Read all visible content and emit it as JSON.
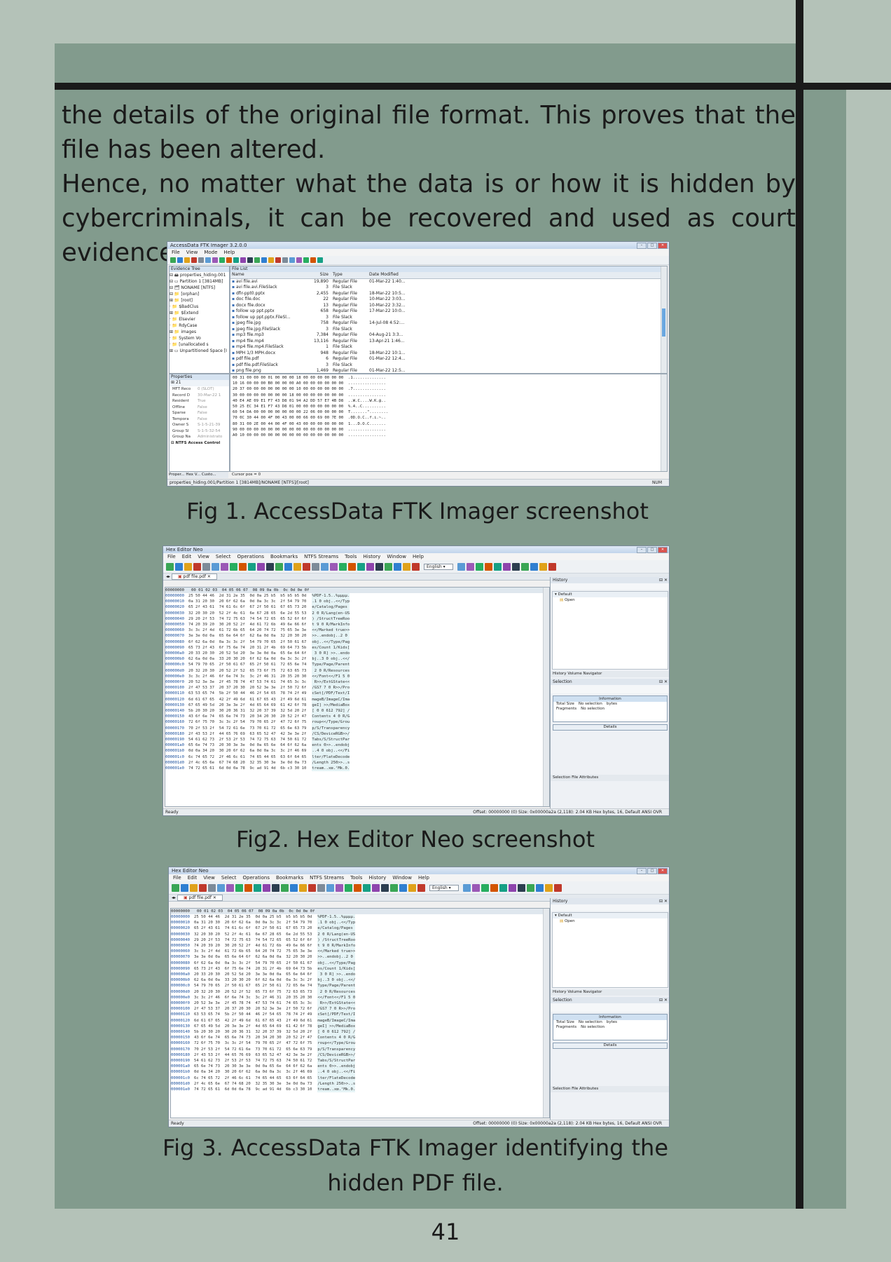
{
  "body": {
    "paragraph1": "the details of the original file format. This proves that the file has been altered.",
    "paragraph2": "Hence, no matter what the data is or how it is hidden by cybercriminals, it can be recovered and used as court evidence."
  },
  "figures": {
    "fig1_caption": "Fig 1. AccessData FTK Imager screenshot",
    "fig2_caption": "Fig2. Hex Editor Neo screenshot",
    "fig3_caption": "Fig 3. AccessData FTK Imager identifying the hidden PDF file."
  },
  "page_number": "41",
  "ftk": {
    "title": "AccessData FTK Imager 3.2.0.0",
    "menu": [
      "File",
      "View",
      "Mode",
      "Help"
    ],
    "evidence_tree_title": "Evidence Tree",
    "file_list_title": "File List",
    "properties_title": "Properties",
    "tree": [
      "⊟ 🖴 properties_hiding.001",
      "  ⊟ ▭ Partition 1 [3814MB]",
      "    ⊟ 🗂 NONAME [NTFS]",
      "      ⊟ 📁 [orphan]",
      "        ⊞ 📁 [root]",
      "          · 📁 $BadClus",
      "          ⊞ 📁 $Extend",
      "          · 📁 Elsevier",
      "          · 📁 RdyCase",
      "        ⊞ 📁 images",
      "          · 📁 System Vo",
      "      · 📁 [unallocated s",
      "  ⊞ ▭ Unpartitioned Space [I"
    ],
    "columns": [
      "Name",
      "Size",
      "Type",
      "Date Modified"
    ],
    "files": [
      [
        "avi file.avi",
        "19,890",
        "Regular File",
        "01-Mar-22 1:40..."
      ],
      [
        "avi file.avi.FileSlack",
        "3",
        "File Slack",
        ""
      ],
      [
        "dfir-ppt0.pptx",
        "2,455",
        "Regular File",
        "18-Mar-22 10:5..."
      ],
      [
        "doc file.doc",
        "22",
        "Regular File",
        "10-Mar-22 3:03..."
      ],
      [
        "docx file.docx",
        "13",
        "Regular File",
        "10-Mar-22 3:32..."
      ],
      [
        "follow up ppt.pptx",
        "658",
        "Regular File",
        "17-Mar-22 10:0..."
      ],
      [
        "follow up ppt.pptx.FileSl...",
        "3",
        "File Slack",
        ""
      ],
      [
        "jpeg file.jpg",
        "758",
        "Regular File",
        "14-Jul-08 4:52:..."
      ],
      [
        "jpeg file.jpg.FileSlack",
        "3",
        "File Slack",
        ""
      ],
      [
        "mp3 file.mp3",
        "7,384",
        "Regular File",
        "04-Aug-21 3:3..."
      ],
      [
        "mp4 file.mp4",
        "13,116",
        "Regular File",
        "13-Apr-21 1:46..."
      ],
      [
        "mp4 file.mp4.FileSlack",
        "1",
        "File Slack",
        ""
      ],
      [
        "MPH 1/3 MPH.docx",
        "948",
        "Regular File",
        "18-Mar-22 10:1..."
      ],
      [
        "pdf file.pdf",
        "6",
        "Regular File",
        "01-Mar-22 12:4..."
      ],
      [
        "pdf file.pdf.FileSlack",
        "3",
        "File Slack",
        ""
      ],
      [
        "png file.png",
        "1,469",
        "Regular File",
        "01-Mar-22 12:5..."
      ]
    ],
    "properties": [
      [
        "MFT Reco",
        "0 (SLOT)"
      ],
      [
        "Record D",
        "30-Mar-22 1"
      ],
      [
        "Resident",
        "True"
      ],
      [
        "Offline",
        "False"
      ],
      [
        "Sparse",
        "False"
      ],
      [
        "Tempora",
        "False"
      ],
      [
        "Owner S",
        "S-1-5-21-39"
      ],
      [
        "Group SI",
        "S-1-5-32-54"
      ],
      [
        "Group Na",
        "Administrato"
      ]
    ],
    "props_section": "⊟ NTFS Access Control",
    "prop_tabs": "Proper... Hex V... Custo...",
    "status_left": "properties_hiding.001/Partition 1 [3814MB]/NONAME [NTFS]/[root]",
    "cursor_pos": "Cursor pos = 0",
    "status_right": "NUM",
    "hex_lines": [
      "00 31 00 00 00 01 00 00 00 18 00 00 00 00 00 00  .1..............",
      "10 16 00 00 00 B0 00 00 00 A0 00 00 00 00 00 00  ................",
      "20 37 00 00 00 00 00 00 00 10 00 00 00 00 00 00  .7..............",
      "30 00 00 00 00 00 00 00 18 00 00 00 00 00 00 00  ................",
      "40 E4 AE 09 E1 F7 43 D8 01 94 A2 DD 57 E7 4B D8  ..W.C....W.K.@..",
      "50 25 EC 34 E1 F7 43 D8 01 00 00 00 00 00 00 00  %.4..C..........",
      "60 54 DA 00 00 00 00 00 00 00 22 06 00 00 00 00  T.......\"........",
      "70 0C 30 44 00 4F 00 43 00 00 66 00 69 00 7E 00  .0D.O.C..f.i.~..",
      "80 31 00 2E 00 44 00 4F 00 43 00 00 00 00 00 00  1...D.O.C.......",
      "90 00 00 00 00 00 00 00 00 00 00 00 00 00 00 00  ................",
      "A0 10 00 00 00 00 00 00 00 00 00 00 00 00 00 00  ................"
    ]
  },
  "hexneo": {
    "title": "Hex Editor Neo",
    "menu": [
      "File",
      "Edit",
      "View",
      "Select",
      "Operations",
      "Bookmarks",
      "NTFS Streams",
      "Tools",
      "History",
      "Window",
      "Help"
    ],
    "tab_label": "pdf file.pdf",
    "lang": "English",
    "history_title": "History",
    "history_default": "Default",
    "history_open": "Open",
    "history_tabs": "History  Volume Navigator",
    "selection_title": "Selection",
    "info_title": "Information",
    "total_size_label": "Total Size",
    "total_size_value": "No selection",
    "bytes_label": "bytes",
    "fragments_label": "Fragments",
    "fragments_value": "No selection",
    "details_label": "Details",
    "selection_tabs": "Selection  File Attributes",
    "status_left": "Ready",
    "status_right": "Offset: 00000000 (0)   Size: 0x00000a2a (2,118): 2.04 KB   Hex bytes, 16, Default ANSI   OVR",
    "header_row": "00000000   00 01 02 03  04 05 06 07  08 09 0a 0b  0c 0d 0e 0f",
    "rows": [
      [
        "00000000",
        "25 50 44 46  2d 31 2e 35  0d 0a 25 b5  b5 b5 b5 0d",
        "%PDF-1.5..%µµµµ."
      ],
      [
        "00000010",
        "0a 31 20 30  20 6f 62 6a  0d 0a 3c 3c  2f 54 79 70",
        ".1 0 obj..<</Typ"
      ],
      [
        "00000020",
        "65 2f 43 61  74 61 6c 6f  67 2f 50 61  67 65 73 20",
        "e/Catalog/Pages "
      ],
      [
        "00000030",
        "32 20 30 20  52 2f 4c 61  6e 67 28 65  6e 2d 55 53",
        "2 0 R/Lang(en-US"
      ],
      [
        "00000040",
        "29 20 2f 53  74 72 75 63  74 54 72 65  65 52 6f 6f",
        ") /StructTreeRoo"
      ],
      [
        "00000050",
        "74 20 39 20  30 20 52 2f  4d 61 72 6b  49 6e 66 6f",
        "t 9 0 R/MarkInfo"
      ],
      [
        "00000060",
        "3c 3c 2f 4d  61 72 6b 65  64 20 74 72  75 65 3e 3e",
        "<</Marked true>>"
      ],
      [
        "00000070",
        "3e 3e 0d 0a  65 6e 64 6f  62 6a 0d 0a  32 20 30 20",
        ">>..endobj..2 0 "
      ],
      [
        "00000080",
        "6f 62 6a 0d  0a 3c 3c 2f  54 79 70 65  2f 50 61 67",
        "obj..<</Type/Pag"
      ],
      [
        "00000090",
        "65 73 2f 43  6f 75 6e 74  20 31 2f 4b  69 64 73 5b",
        "es/Count 1/Kids["
      ],
      [
        "000000a0",
        "20 33 20 30  20 52 5d 20  3e 3e 0d 0a  65 6e 64 6f",
        " 3 0 R] >>..endo"
      ],
      [
        "000000b0",
        "62 6a 0d 0a  33 20 30 20  6f 62 6a 0d  0a 3c 3c 2f",
        "bj..3 0 obj..<</"
      ],
      [
        "000000c0",
        "54 79 70 65  2f 50 61 67  65 2f 50 61  72 65 6e 74",
        "Type/Page/Parent"
      ],
      [
        "000000d0",
        "20 32 20 30  20 52 2f 52  65 73 6f 75  72 63 65 73",
        " 2 0 R/Resources"
      ],
      [
        "000000e0",
        "3c 3c 2f 46  6f 6e 74 3c  3c 2f 46 31  20 35 20 30",
        "<</Font<</F1 5 0"
      ],
      [
        "000000f0",
        "20 52 3e 3e  2f 45 78 74  47 53 74 61  74 65 3c 3c",
        " R>>/ExtGState<<"
      ],
      [
        "00000100",
        "2f 47 53 37  20 37 20 30  20 52 3e 3e  2f 50 72 6f",
        "/GS7 7 0 R>>/Pro"
      ],
      [
        "00000110",
        "63 53 65 74  5b 2f 50 44  46 2f 54 65  78 74 2f 49",
        "cSet[/PDF/Text/I"
      ],
      [
        "00000120",
        "6d 61 67 65  42 2f 49 6d  61 67 65 43  2f 49 6d 61",
        "mageB/ImageC/Ima"
      ],
      [
        "00000130",
        "67 65 49 5d  20 3e 3e 2f  4d 65 64 69  61 42 6f 78",
        "geI] >>/MediaBox"
      ],
      [
        "00000140",
        "5b 20 30 20  30 20 36 31  32 20 37 39  32 5d 20 2f",
        "[ 0 0 612 792] /"
      ],
      [
        "00000150",
        "43 6f 6e 74  65 6e 74 73  20 34 20 30  20 52 2f 47",
        "Contents 4 0 R/G"
      ],
      [
        "00000160",
        "72 6f 75 70  3c 3c 2f 54  79 70 65 2f  47 72 6f 75",
        "roup<</Type/Grou"
      ],
      [
        "00000170",
        "70 2f 53 2f  54 72 61 6e  73 70 61 72  65 6e 63 79",
        "p/S/Transparency"
      ],
      [
        "00000180",
        "2f 43 53 2f  44 65 76 69  63 65 52 47  42 3e 3e 2f",
        "/CS/DeviceRGB>>/"
      ],
      [
        "00000190",
        "54 61 62 73  2f 53 2f 53  74 72 75 63  74 50 61 72",
        "Tabs/S/StructPar"
      ],
      [
        "000001a0",
        "65 6e 74 73  20 30 3e 3e  0d 0a 65 6e  64 6f 62 6a",
        "ents 0>>..endobj"
      ],
      [
        "000001b0",
        "0d 0a 34 20  30 20 6f 62  6a 0d 0a 3c  3c 2f 46 69",
        "..4 0 obj..<</Fi"
      ],
      [
        "000001c0",
        "6c 74 65 72  2f 46 6c 61  74 65 44 65  63 6f 64 65",
        "lter/FlateDecode"
      ],
      [
        "000001d0",
        "2f 4c 65 6e  67 74 68 20  32 35 30 3e  3e 0d 0a 73",
        "/Length 250>>..s"
      ],
      [
        "000001e0",
        "74 72 65 61  6d 0d 0a 78  9c ad 91 4d  6b c3 30 10",
        "tream..xœ.‘Mk.0."
      ]
    ]
  }
}
